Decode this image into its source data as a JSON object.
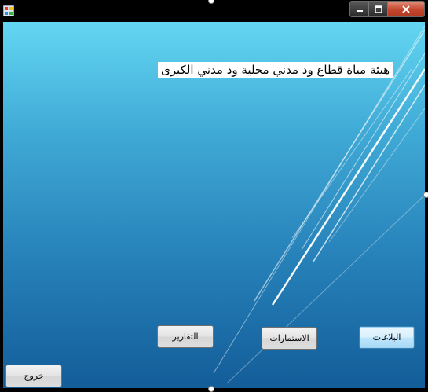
{
  "window": {
    "controls": {
      "minimize_icon": "minimize-icon",
      "maximize_icon": "maximize-icon",
      "close_icon": "close-icon"
    }
  },
  "main": {
    "heading": "هيئة مياة قطاع  ود مدني محلية ود مدني الكبرى"
  },
  "buttons": {
    "reports": "التقارير",
    "forms": "الاستمارات",
    "notices": "البلاغات",
    "exit": "خروج"
  },
  "colors": {
    "gradient_top": "#63d6f2",
    "gradient_bottom": "#135d99",
    "close_button": "#c4452c"
  }
}
